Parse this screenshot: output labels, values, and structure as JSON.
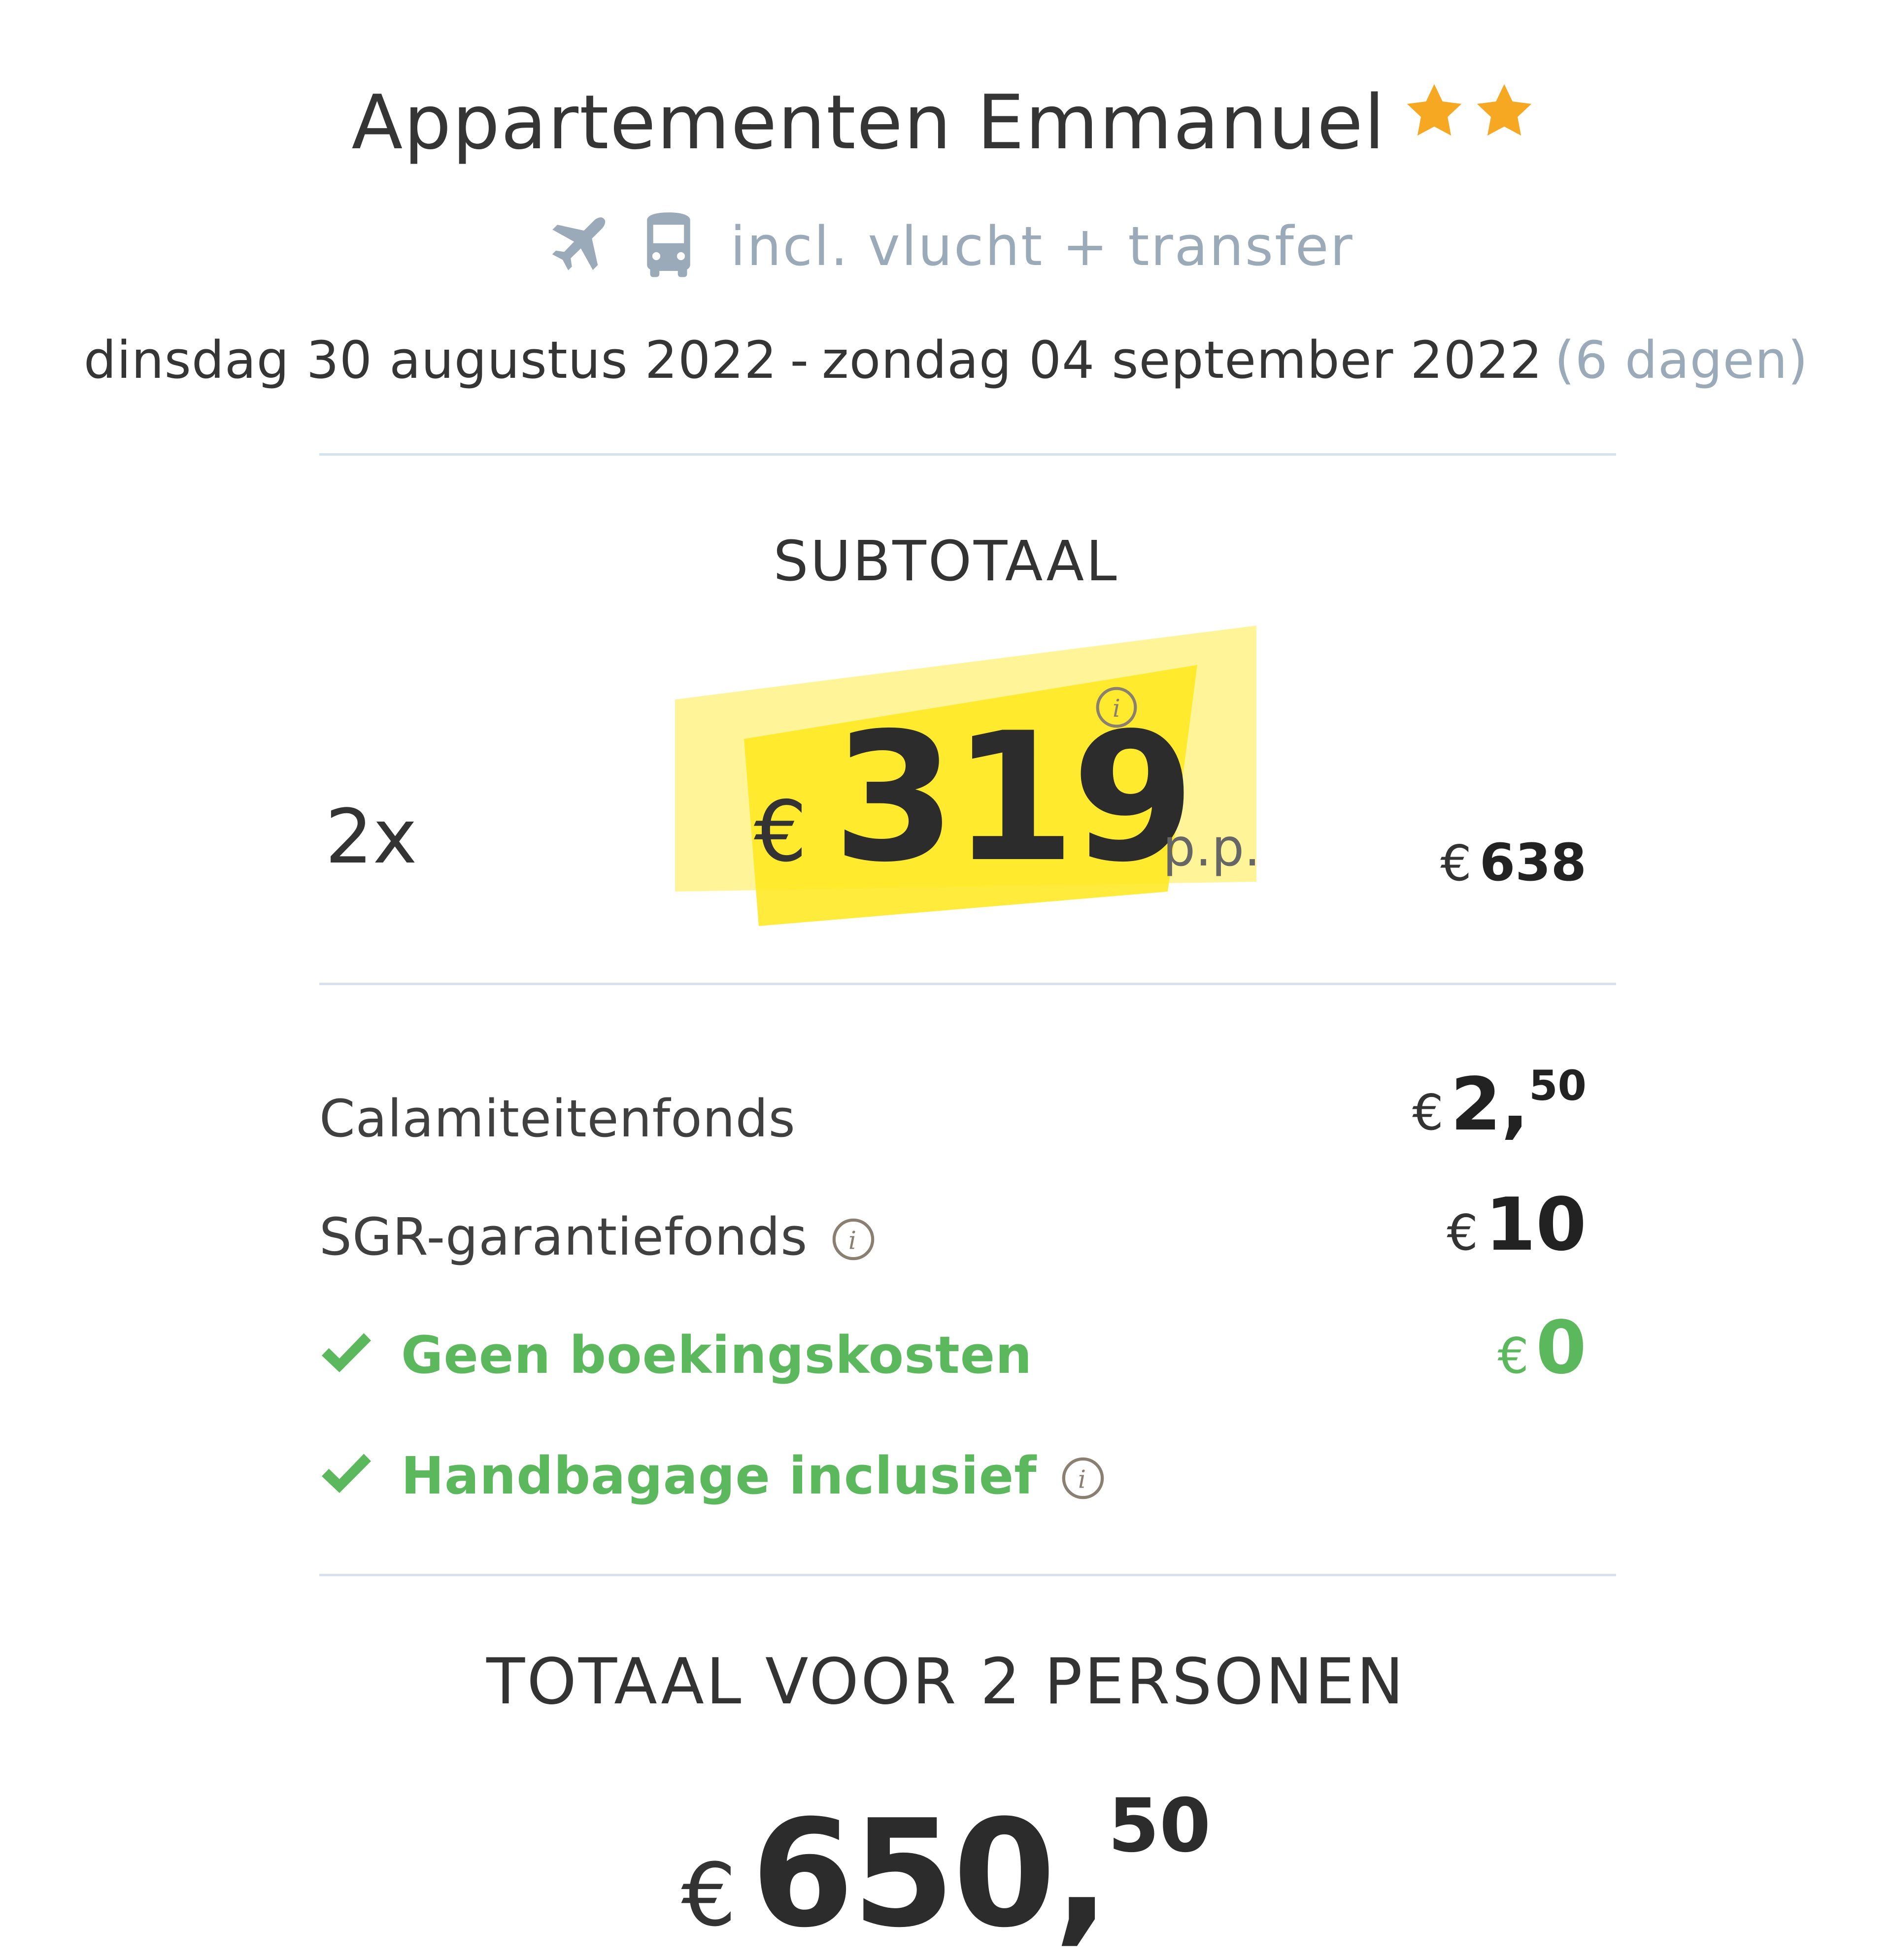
{
  "hotel": {
    "name": "Appartementen Emmanuel",
    "stars": 2,
    "star_color": "#f6a823"
  },
  "includes": {
    "icons": [
      "airplane-icon",
      "bus-icon"
    ],
    "text": "incl. vlucht + transfer"
  },
  "dates": {
    "start": "dinsdag 30 augustus 2022",
    "separator": "-",
    "end": "zondag 04 september 2022",
    "duration": "(6 dagen)"
  },
  "subtotal": {
    "heading": "SUBTOTAAL",
    "quantity": "2x",
    "currency": "€",
    "price_pp": "319",
    "pp_label": "p.p.",
    "row_currency": "€",
    "row_total": "638",
    "highlight_color": "#ffe81a"
  },
  "costs": [
    {
      "label": "Calamiteitenfonds",
      "currency": "€",
      "amount": "2,",
      "decimals": "50"
    },
    {
      "label": "SGR-garantiefonds",
      "currency": "€",
      "amount": "10",
      "info_icon": true
    },
    {
      "label": "Geen boekingskosten",
      "currency": "€",
      "amount": "0",
      "check": true,
      "color": "#5cb85c"
    },
    {
      "label": "Handbagage inclusief",
      "check": true,
      "info_icon": true,
      "color": "#5cb85c"
    }
  ],
  "total": {
    "heading": "TOTAAL VOOR 2 PERSONEN",
    "currency": "€",
    "amount": "650,",
    "decimals": "50"
  }
}
